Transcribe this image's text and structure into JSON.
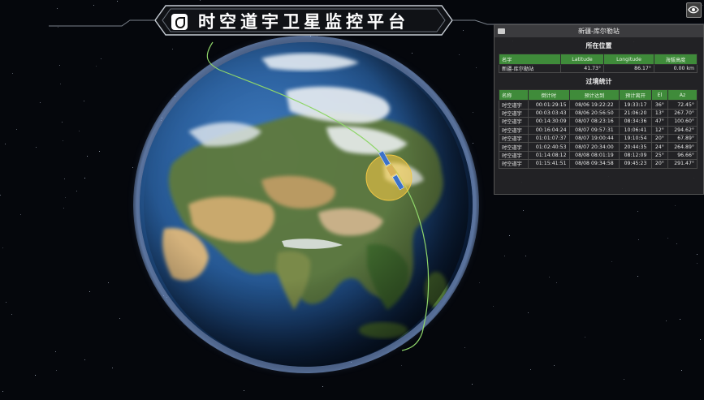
{
  "title": "时空道宇卫星监控平台",
  "panel": {
    "station_name": "新疆-库尔勒站",
    "location_heading": "所在位置",
    "location_columns": [
      "名字",
      "Latitude",
      "Longitude",
      "海拔高度"
    ],
    "location_row": [
      "新疆-库尔勒站",
      "41.73°",
      "86.17°",
      "0.00 km"
    ],
    "pass_heading": "过境统计",
    "pass_columns": [
      "名称",
      "倒计时",
      "预计达到",
      "预计离开",
      "El",
      "Az"
    ],
    "pass_rows": [
      [
        "时空道宇",
        "00:01:29:15",
        "08/06 19:22:22",
        "19:33:17",
        "36°",
        "72.45°"
      ],
      [
        "时空道宇",
        "00:03:03:43",
        "08/06 20:56:50",
        "21:06:20",
        "13°",
        "267.70°"
      ],
      [
        "时空道宇",
        "00:14:30:09",
        "08/07 08:23:16",
        "08:34:36",
        "47°",
        "100.60°"
      ],
      [
        "时空道宇",
        "00:16:04:24",
        "08/07 09:57:31",
        "10:06:41",
        "12°",
        "294.62°"
      ],
      [
        "时空道宇",
        "01:01:07:37",
        "08/07 19:00:44",
        "19:10:54",
        "20°",
        "67.89°"
      ],
      [
        "时空道宇",
        "01:02:40:53",
        "08/07 20:34:00",
        "20:44:35",
        "24°",
        "264.89°"
      ],
      [
        "时空道宇",
        "01:14:08:12",
        "08/08 08:01:19",
        "08:12:09",
        "25°",
        "96.66°"
      ],
      [
        "时空道宇",
        "01:15:41:51",
        "08/08 09:34:58",
        "09:45:23",
        "20°",
        "291.47°"
      ]
    ]
  },
  "icons": {
    "logo": "app-logo-icon",
    "eye": "eye-icon",
    "panel": "camera-icon",
    "satellite": "satellite-icon"
  },
  "colors": {
    "orbit": "#8fd66a",
    "header_green": "#3f8b3a",
    "coverage": "#f2c744"
  }
}
